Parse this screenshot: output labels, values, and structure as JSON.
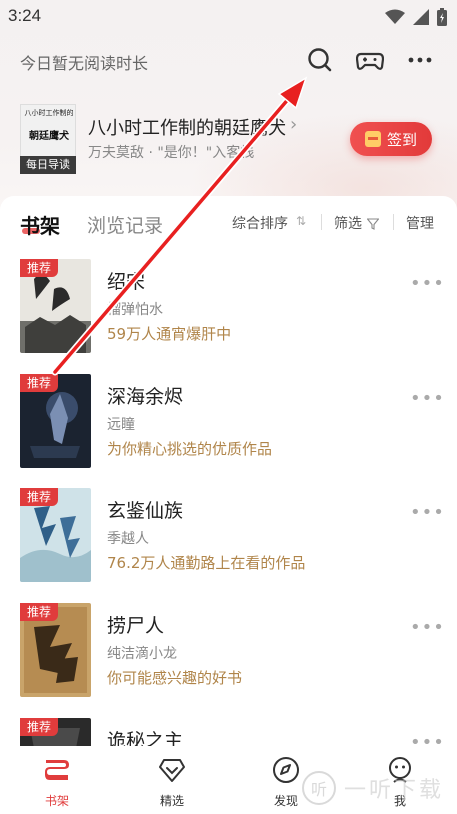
{
  "status_bar": {
    "time": "3:24"
  },
  "header": {
    "reading_hint": "今日暂无阅读时长",
    "icons": [
      "search-icon",
      "gamepad-icon",
      "more-icon"
    ]
  },
  "daily": {
    "cover_text": "八小时工作制的",
    "cover_title": "朝廷鹰犬",
    "badge": "每日导读",
    "title": "八小时工作制的朝廷鹰犬",
    "subtitle": "万夫莫敌 · \"是你！\"入客栈",
    "checkin_label": "签到"
  },
  "tabs": {
    "shelf": "书架",
    "history": "浏览记录",
    "sort": "综合排序",
    "sort_arrows": "⇅",
    "filter": "筛选",
    "manage": "管理"
  },
  "books": [
    {
      "tag": "推荐",
      "title": "绍宋",
      "author": "榴弹怕水",
      "desc": "59万人通宵爆肝中",
      "more": "•••"
    },
    {
      "tag": "推荐",
      "title": "深海余烬",
      "author": "远瞳",
      "desc": "为你精心挑选的优质作品",
      "more": "•••"
    },
    {
      "tag": "推荐",
      "title": "玄鉴仙族",
      "author": "季越人",
      "desc": "76.2万人通勤路上在看的作品",
      "more": "•••"
    },
    {
      "tag": "推荐",
      "title": "捞尸人",
      "author": "纯洁滴小龙",
      "desc": "你可能感兴趣的好书",
      "more": "•••"
    },
    {
      "tag": "推荐",
      "title": "诡秘之主",
      "author": "",
      "desc": "",
      "more": "•••"
    }
  ],
  "nav": {
    "shelf": "书架",
    "featured": "精选",
    "discover": "发现",
    "me": "我"
  },
  "watermark": {
    "text": "一听下载",
    "circle": "听"
  },
  "colors": {
    "accent": "#e03c3c",
    "desc": "#b0854a"
  }
}
